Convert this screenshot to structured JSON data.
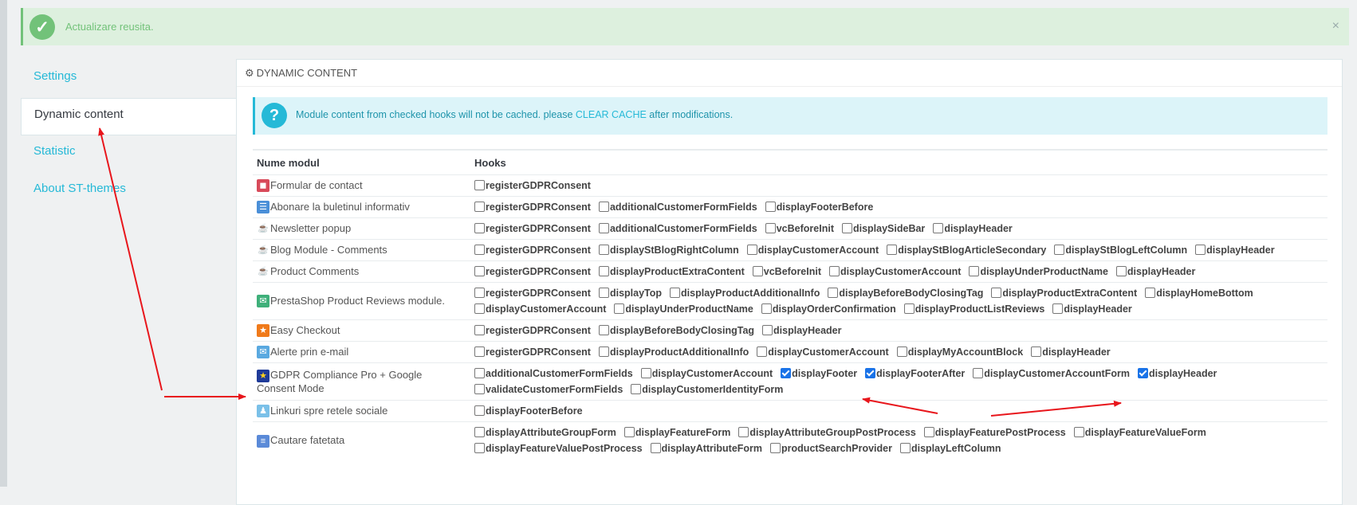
{
  "alert": {
    "message": "Actualizare reusita.",
    "close": "×"
  },
  "tabs": [
    {
      "label": "Settings",
      "active": false
    },
    {
      "label": "Dynamic content",
      "active": true
    },
    {
      "label": "Statistic",
      "active": false
    },
    {
      "label": "About ST-themes",
      "active": false
    }
  ],
  "panel": {
    "heading": "Dynamic Content",
    "info": {
      "before": "Module content from checked hooks will not be cached. please ",
      "link": "CLEAR CACHE",
      "after": " after modifications."
    },
    "table": {
      "col_module": "Nume modul",
      "col_hooks": "Hooks",
      "rows": [
        {
          "module": "Formular de contact",
          "icon": "contact-form-icon",
          "height": 27,
          "lines": [
            [
              {
                "name": "registerGDPRConsent",
                "checked": false
              }
            ]
          ]
        },
        {
          "module": "Abonare la buletinul informativ",
          "icon": "newsletter-icon",
          "height": 27,
          "lines": [
            [
              {
                "name": "registerGDPRConsent",
                "checked": false
              },
              {
                "name": "additionalCustomerFormFields",
                "checked": false
              },
              {
                "name": "displayFooterBefore",
                "checked": false
              }
            ]
          ]
        },
        {
          "module": "Newsletter popup",
          "icon": "st-themes-icon",
          "height": 27,
          "lines": [
            [
              {
                "name": "registerGDPRConsent",
                "checked": false
              },
              {
                "name": "additionalCustomerFormFields",
                "checked": false
              },
              {
                "name": "vcBeforeInit",
                "checked": false
              },
              {
                "name": "displaySideBar",
                "checked": false
              },
              {
                "name": "displayHeader",
                "checked": false
              }
            ]
          ]
        },
        {
          "module": "Blog Module - Comments",
          "icon": "st-themes-icon",
          "height": 27,
          "lines": [
            [
              {
                "name": "registerGDPRConsent",
                "checked": false
              },
              {
                "name": "displayStBlogRightColumn",
                "checked": false
              },
              {
                "name": "displayCustomerAccount",
                "checked": false
              },
              {
                "name": "displayStBlogArticleSecondary",
                "checked": false
              },
              {
                "name": "displayStBlogLeftColumn",
                "checked": false
              },
              {
                "name": "displayHeader",
                "checked": false
              }
            ]
          ]
        },
        {
          "module": "Product Comments",
          "icon": "st-themes-icon",
          "height": 27,
          "lines": [
            [
              {
                "name": "registerGDPRConsent",
                "checked": false
              },
              {
                "name": "displayProductExtraContent",
                "checked": false
              },
              {
                "name": "vcBeforeInit",
                "checked": false
              },
              {
                "name": "displayCustomerAccount",
                "checked": false
              },
              {
                "name": "displayUnderProductName",
                "checked": false
              },
              {
                "name": "displayHeader",
                "checked": false
              }
            ]
          ]
        },
        {
          "module": "PrestaShop Product Reviews module.",
          "icon": "reviews-icon",
          "height": 47,
          "lines": [
            [
              {
                "name": "registerGDPRConsent",
                "checked": false
              },
              {
                "name": "displayTop",
                "checked": false
              },
              {
                "name": "displayProductAdditionalInfo",
                "checked": false
              },
              {
                "name": "displayBeforeBodyClosingTag",
                "checked": false
              },
              {
                "name": "displayProductExtraContent",
                "checked": false
              },
              {
                "name": "displayHomeBottom",
                "checked": false
              }
            ],
            [
              {
                "name": "displayCustomerAccount",
                "checked": false
              },
              {
                "name": "displayUnderProductName",
                "checked": false
              },
              {
                "name": "displayOrderConfirmation",
                "checked": false
              },
              {
                "name": "displayProductListReviews",
                "checked": false
              },
              {
                "name": "displayHeader",
                "checked": false
              }
            ]
          ]
        },
        {
          "module": "Easy Checkout",
          "icon": "easy-checkout-icon",
          "height": 27,
          "lines": [
            [
              {
                "name": "registerGDPRConsent",
                "checked": false
              },
              {
                "name": "displayBeforeBodyClosingTag",
                "checked": false
              },
              {
                "name": "displayHeader",
                "checked": false
              }
            ]
          ]
        },
        {
          "module": "Alerte prin e-mail",
          "icon": "email-alerts-icon",
          "height": 27,
          "lines": [
            [
              {
                "name": "registerGDPRConsent",
                "checked": false
              },
              {
                "name": "displayProductAdditionalInfo",
                "checked": false
              },
              {
                "name": "displayCustomerAccount",
                "checked": false
              },
              {
                "name": "displayMyAccountBlock",
                "checked": false
              },
              {
                "name": "displayHeader",
                "checked": false
              }
            ]
          ]
        },
        {
          "module": "GDPR Compliance Pro + Google Consent Mode",
          "icon": "eu-flag-icon",
          "height": 47,
          "lines": [
            [
              {
                "name": "additionalCustomerFormFields",
                "checked": false
              },
              {
                "name": "displayCustomerAccount",
                "checked": false
              },
              {
                "name": "displayFooter",
                "checked": true
              },
              {
                "name": "displayFooterAfter",
                "checked": true
              },
              {
                "name": "displayCustomerAccountForm",
                "checked": false
              },
              {
                "name": "displayHeader",
                "checked": true
              }
            ],
            [
              {
                "name": "validateCustomerFormFields",
                "checked": false
              },
              {
                "name": "displayCustomerIdentityForm",
                "checked": false
              }
            ]
          ]
        },
        {
          "module": "Linkuri spre retele sociale",
          "icon": "social-links-icon",
          "height": 27,
          "lines": [
            [
              {
                "name": "displayFooterBefore",
                "checked": false
              }
            ]
          ]
        },
        {
          "module": "Cautare fatetata",
          "icon": "faceted-search-icon",
          "height": 47,
          "lines": [
            [
              {
                "name": "displayAttributeGroupForm",
                "checked": false
              },
              {
                "name": "displayFeatureForm",
                "checked": false
              },
              {
                "name": "displayAttributeGroupPostProcess",
                "checked": false
              },
              {
                "name": "displayFeaturePostProcess",
                "checked": false
              },
              {
                "name": "displayFeatureValueForm",
                "checked": false
              }
            ],
            [
              {
                "name": "displayFeatureValuePostProcess",
                "checked": false
              },
              {
                "name": "displayAttributeForm",
                "checked": false
              },
              {
                "name": "productSearchProvider",
                "checked": false
              },
              {
                "name": "displayLeftColumn",
                "checked": false
              }
            ]
          ]
        }
      ]
    }
  },
  "colors": {
    "accent": "#25b9d7",
    "success": "#72c279",
    "arrow": "#e8161c",
    "checked": "#1a73e8"
  }
}
